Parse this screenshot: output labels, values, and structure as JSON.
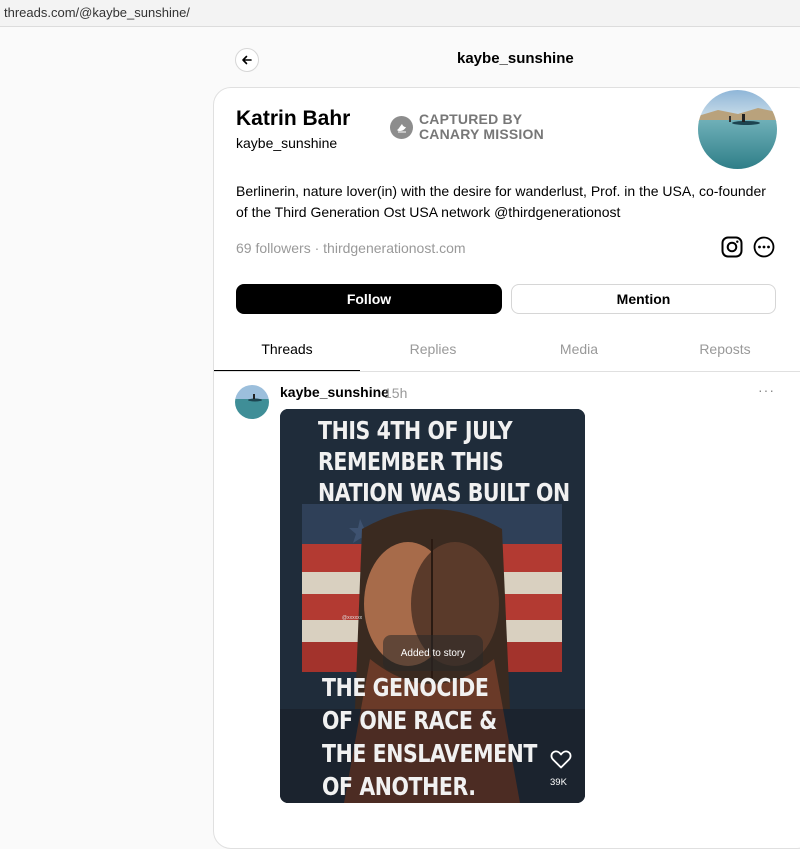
{
  "browser": {
    "url": "threads.com/@kaybe_sunshine/"
  },
  "header": {
    "title": "kaybe_sunshine"
  },
  "profile": {
    "name": "Katrin Bahr",
    "handle": "kaybe_sunshine",
    "badge_line1": "CAPTURED BY",
    "badge_line2": "CANARY MISSION",
    "bio": "Berlinerin, nature lover(in) with the desire for wanderlust, Prof. in the USA, co-founder of the Third Generation Ost USA network @thirdgenerationost",
    "followers": "69 followers",
    "separator": "·",
    "website": "thirdgenerationost.com"
  },
  "buttons": {
    "follow": "Follow",
    "mention": "Mention"
  },
  "tabs": [
    {
      "label": "Threads",
      "active": true
    },
    {
      "label": "Replies",
      "active": false
    },
    {
      "label": "Media",
      "active": false
    },
    {
      "label": "Reposts",
      "active": false
    }
  ],
  "post": {
    "username": "kaybe_sunshine",
    "time": "15h",
    "more": "···",
    "image": {
      "headline_line1": "THIS 4TH OF JULY",
      "headline_line2": "REMEMBER THIS",
      "headline_line3": "NATION WAS BUILT ON",
      "bottom_line1": "THE GENOCIDE",
      "bottom_line2": "OF ONE RACE &",
      "bottom_line3": "THE ENSLAVEMENT",
      "bottom_line4": "OF ANOTHER.",
      "watermark": "@xxxxxx",
      "story_toast": "Added to story",
      "likes": "39K"
    }
  },
  "colors": {
    "accent": "#000000",
    "muted": "#999999",
    "badge_gray": "#8d8d8d"
  },
  "icons": [
    "back-arrow-icon",
    "canary-mission-icon",
    "instagram-icon",
    "more-options-icon",
    "heart-icon"
  ]
}
